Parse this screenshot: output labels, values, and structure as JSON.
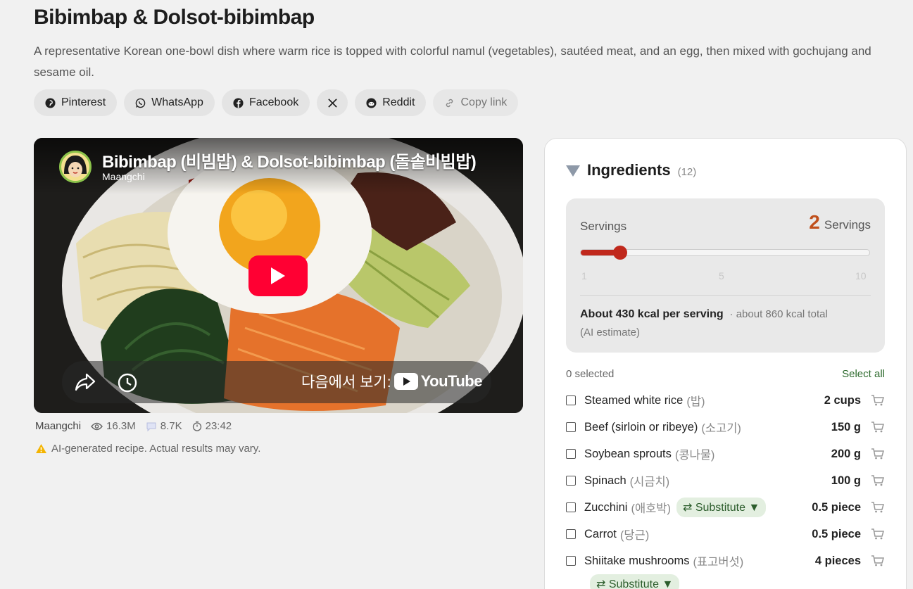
{
  "recipe": {
    "title": "Bibimbap & Dolsot-bibimbap",
    "description": "A representative Korean one-bowl dish where warm rice is topped with colorful namul (vegetables), sautéed meat, and an egg, then mixed with gochujang and sesame oil."
  },
  "share": {
    "pinterest": "Pinterest",
    "whatsapp": "WhatsApp",
    "facebook": "Facebook",
    "x_icon": "x-icon",
    "reddit": "Reddit",
    "copy_link": "Copy link"
  },
  "video": {
    "title": "Bibimbap (비빔밥) & Dolsot-bibimbap (돌솥비빔밥)",
    "channel": "Maangchi",
    "watch_on": "다음에서 보기:",
    "youtube": "YouTube"
  },
  "meta": {
    "author": "Maangchi",
    "views": "16.3M",
    "comments": "8.7K",
    "duration": "23:42",
    "disclaimer": "AI-generated recipe. Actual results may vary."
  },
  "ingredients": {
    "title": "Ingredients",
    "count": "(12)",
    "servings_label": "Servings",
    "servings_value": "2",
    "servings_unit": "Servings",
    "slider_min": "1",
    "slider_mid": "5",
    "slider_max": "10",
    "slider_fraction": 0.111,
    "kcal_main": "About 430 kcal per serving",
    "kcal_total": "· about 860 kcal total",
    "kcal_note": "(AI estimate)",
    "selected": "0 selected",
    "select_all": "Select all",
    "substitute_label": "⇄ Substitute ▼",
    "items": [
      {
        "name": "Steamed white rice",
        "kr": "(밥)",
        "qty": "2 cups"
      },
      {
        "name": "Beef (sirloin or ribeye)",
        "kr": "(소고기)",
        "qty": "150 g"
      },
      {
        "name": "Soybean sprouts",
        "kr": "(콩나물)",
        "qty": "200 g"
      },
      {
        "name": "Spinach",
        "kr": "(시금치)",
        "qty": "100 g"
      },
      {
        "name": "Zucchini",
        "kr": "(애호박)",
        "qty": "0.5 piece"
      },
      {
        "name": "Carrot",
        "kr": "(당근)",
        "qty": "0.5 piece"
      },
      {
        "name": "Shiitake mushrooms",
        "kr": "(표고버섯)",
        "qty": "4 pieces"
      }
    ]
  },
  "colors": {
    "accent_orange": "#c0501c",
    "slider_red": "#c0281c",
    "substitute_green": "#2c5d2c",
    "youtube_red": "#ff0033"
  }
}
